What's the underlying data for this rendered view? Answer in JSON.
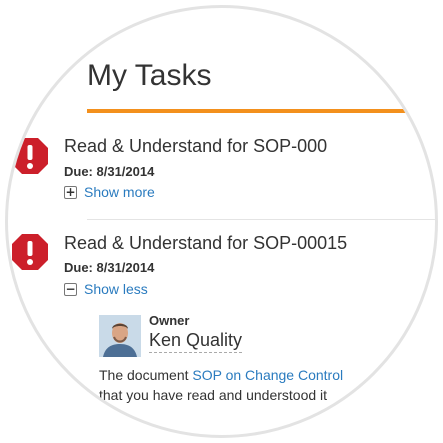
{
  "page": {
    "title": "My Tasks"
  },
  "colors": {
    "accent": "#f3901d",
    "link": "#2a7bbf",
    "alert": "#cc1f2a"
  },
  "tasks": [
    {
      "title": "Read & Understand for SOP-000",
      "due": "Due: 8/31/2014",
      "toggle_label": "Show more",
      "toggle_icon": "plus-box-icon",
      "toggle_symbol": "+"
    },
    {
      "title": "Read & Understand for SOP-00015",
      "due": "Due: 8/31/2014",
      "toggle_label": "Show less",
      "toggle_icon": "minus-box-icon",
      "toggle_symbol": "−",
      "owner_label": "Owner",
      "owner_name": "Ken Quality",
      "description_prefix": "The document ",
      "document_link": "SOP on Change Control",
      "description_line2": "that you have read and understood it"
    }
  ]
}
